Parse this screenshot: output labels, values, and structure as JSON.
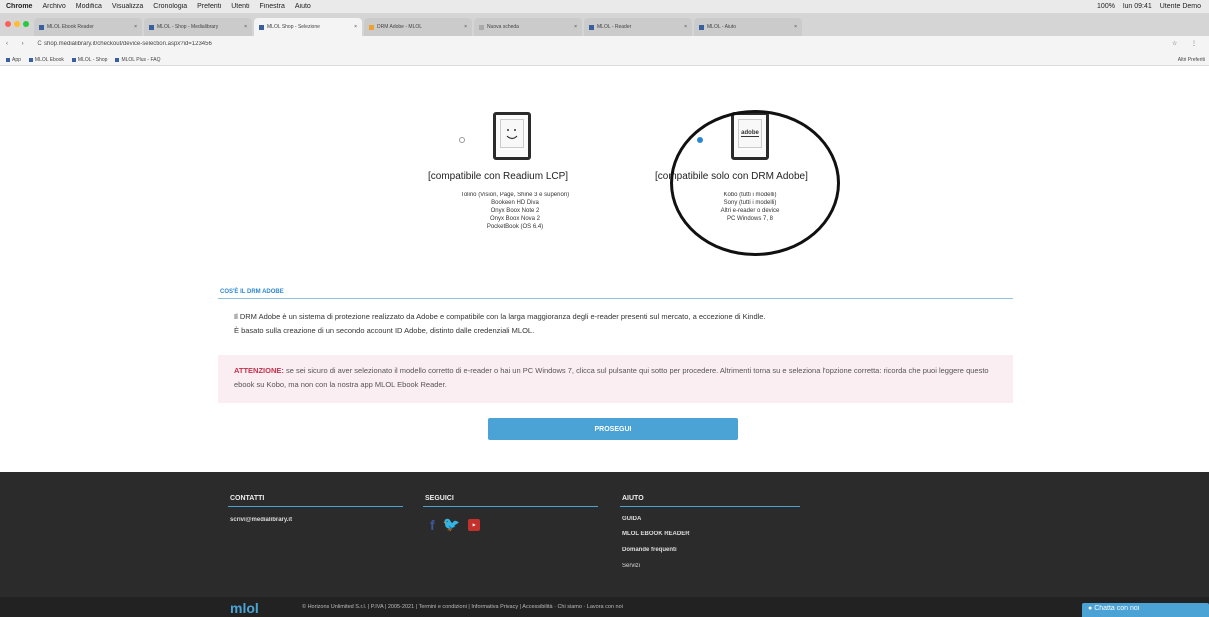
{
  "menubar": {
    "items": [
      "Chrome",
      "Archivo",
      "Modifica",
      "Visualizza",
      "Cronologia",
      "Preferiti",
      "Utenti",
      "Finestra",
      "Aiuto"
    ],
    "right": [
      "100%",
      "lun 09:41",
      "Utente Demo"
    ]
  },
  "tabs": [
    {
      "label": "MLOL Ebook Reader",
      "active": false
    },
    {
      "label": "MLOL - Shop - Medialibrary",
      "active": false
    },
    {
      "label": "MLOL Shop - Selezione",
      "active": true
    },
    {
      "label": "DRM Adobe - MLOL",
      "active": false
    },
    {
      "label": "Nuova scheda",
      "active": false
    },
    {
      "label": "MLOL - Reader",
      "active": false
    },
    {
      "label": "MLOL - Aiuto",
      "active": false
    }
  ],
  "addressbar": {
    "nav": "‹ › C",
    "url": "shop.medialibrary.it/checkout/device-selection.aspx?id=123456",
    "tools": "☆ ⋮"
  },
  "bookmarks": {
    "items": [
      "App",
      "MLOL Ebook",
      "MLOL - Shop",
      "MLOL Plus - FAQ"
    ],
    "other": "Altri Preferiti"
  },
  "options": {
    "lcp": {
      "selected": false,
      "title": "[compatibile con Readium LCP]",
      "devices": [
        "Tolino (Vision, Page, Shine 3 e superiori)",
        "Bookeen HD Diva",
        "Onyx Boox Note 2",
        "Onyx Boox Nova 2",
        "PocketBook (OS 6.4)"
      ]
    },
    "adobe": {
      "selected": true,
      "title": "[compatibile solo con DRM Adobe]",
      "screen_label": "adobe",
      "devices": [
        "Kobo (tutti i modelli)",
        "Sony (tutti i modelli)",
        "Altri e-reader o device",
        "PC Windows 7, 8"
      ]
    }
  },
  "drm": {
    "heading": "COS'È IL DRM ADOBE",
    "text_line1": "Il DRM Adobe è un sistema di protezione realizzato da Adobe e compatibile con la larga maggioranza degli e-reader presenti sul mercato, a eccezione di Kindle.",
    "text_line2": "È basato sulla creazione di un secondo account ID Adobe, distinto dalle credenziali MLOL."
  },
  "warning": {
    "label": "ATTENZIONE:",
    "text": " se sei sicuro di aver selezionato il modello corretto di e-reader o hai un PC Windows 7, clicca sul pulsante qui sotto per procedere. Altrimenti torna su e seleziona l'opzione corretta: ricorda che puoi leggere questo ebook su Kobo, ma non con la nostra app MLOL Ebook Reader."
  },
  "proceed_label": "PROSEGUI",
  "footer": {
    "contacts_title": "CONTATTI",
    "contacts_email": "scrivi@medialibrary.it",
    "follow_title": "SEGUICI",
    "help_title": "AIUTO",
    "help_links": [
      "GUIDA",
      "MLOL EBOOK READER",
      "Domande frequenti",
      "Servizi"
    ],
    "logo": "mlol",
    "copyright": "© Horizons Unlimited S.r.l. | P.IVA | 2005-2021 | Termini e condizioni | Informativa Privacy | Accessibilità · Chi siamo · Lavora con noi",
    "chat": "Chatta con noi"
  }
}
